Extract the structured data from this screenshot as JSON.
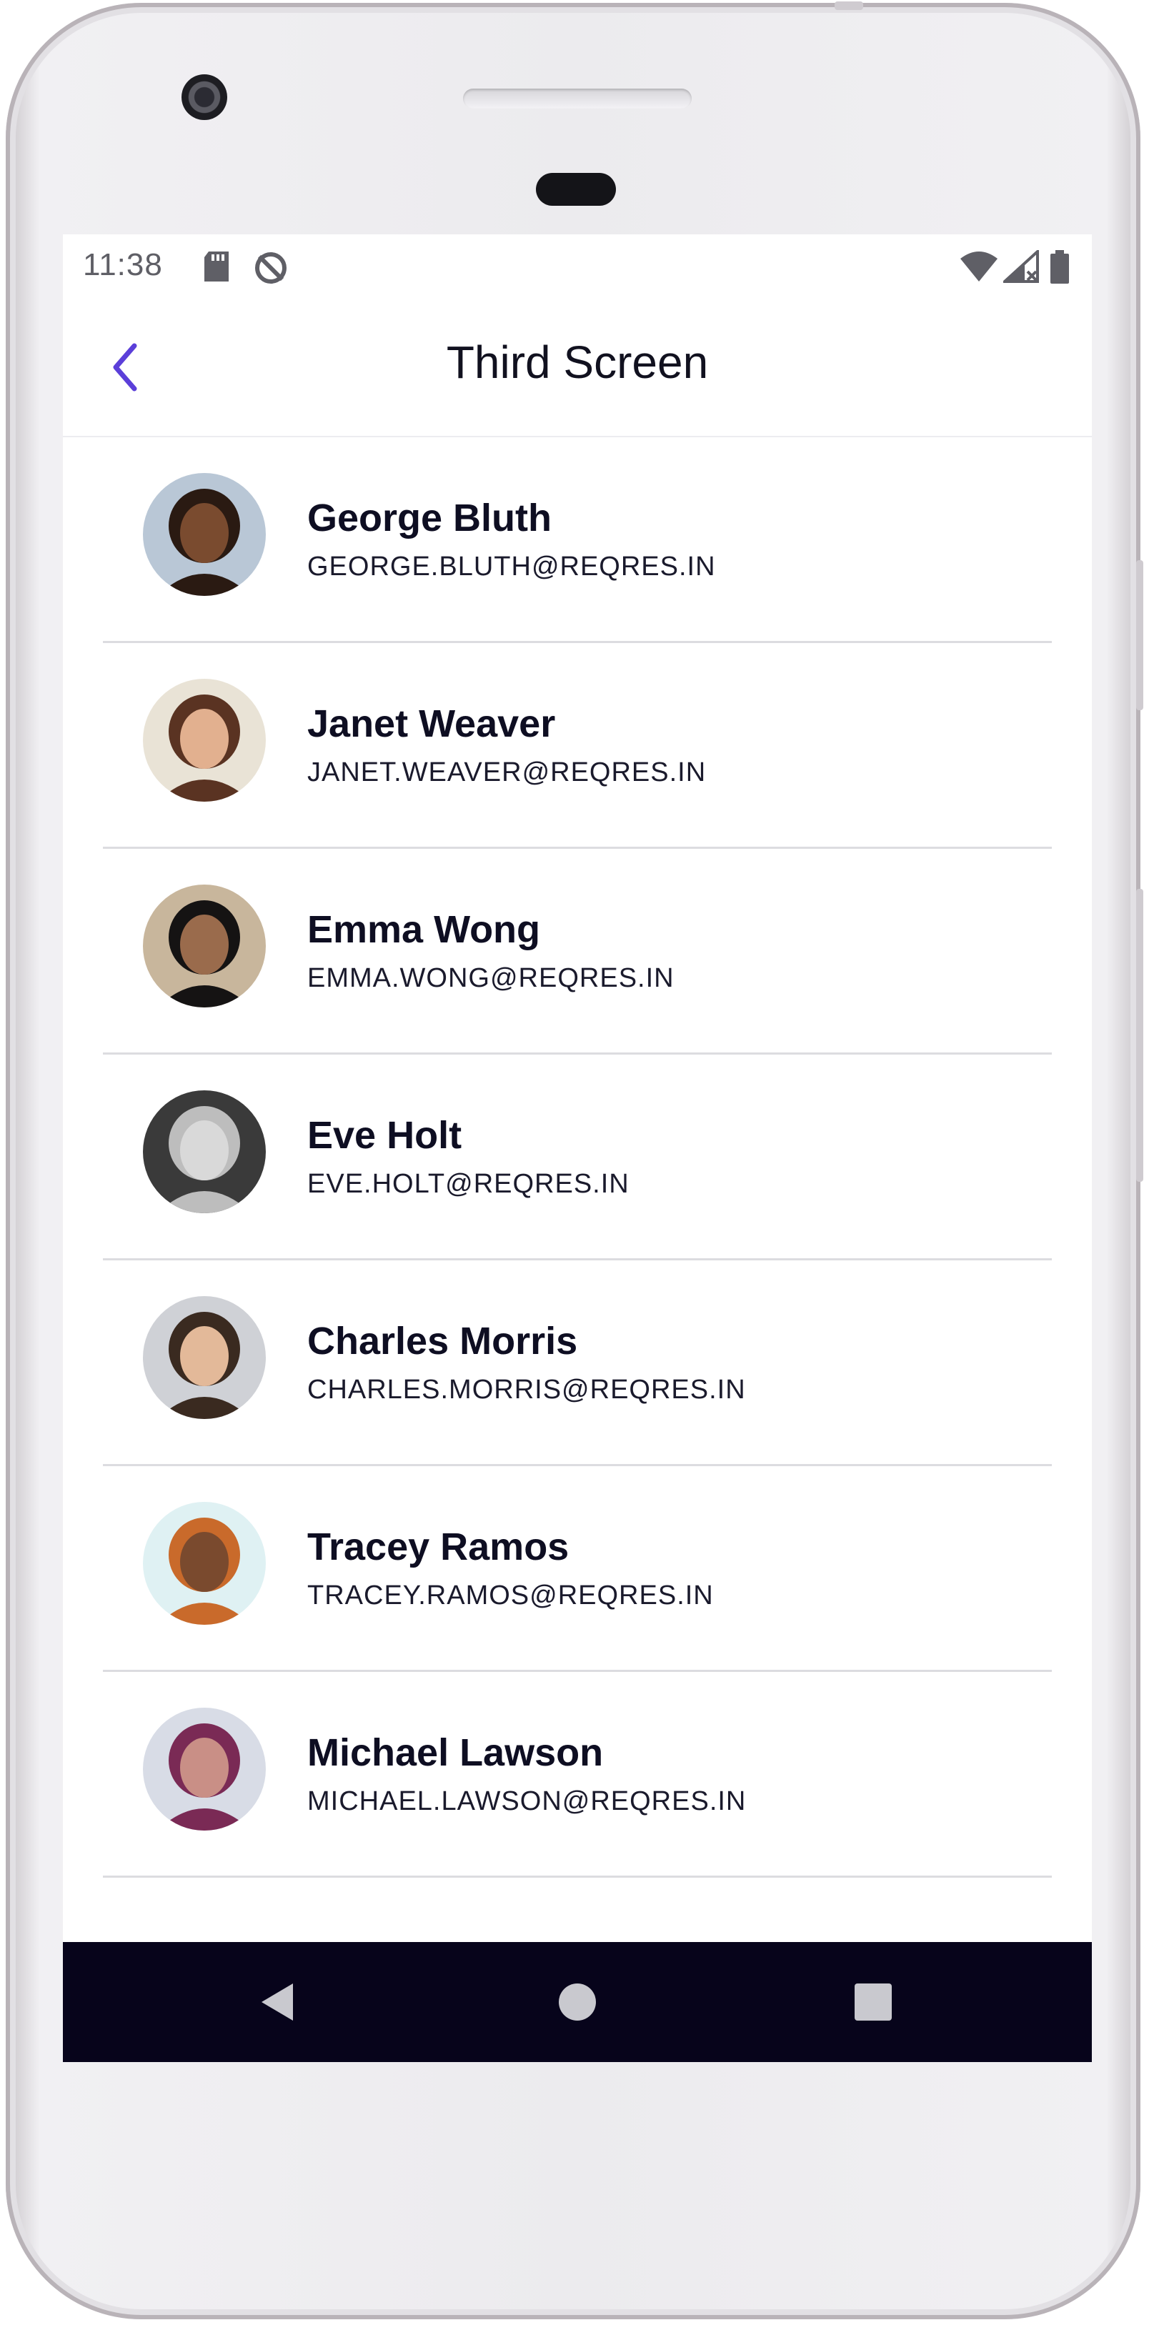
{
  "status_bar": {
    "time": "11:38",
    "icons": [
      "sd-card-icon",
      "sync-disabled-icon",
      "wifi-icon",
      "signal-icon",
      "battery-icon"
    ]
  },
  "app_bar": {
    "title": "Third Screen",
    "back_icon": "chevron-left-icon",
    "accent_color": "#5b3fd9"
  },
  "users": [
    {
      "name": "George Bluth",
      "email": "GEORGE.BLUTH@REQRES.IN",
      "avatar_bg": "#b9c7d6",
      "skin": "#7a4b2f",
      "hair": "#2a1a12"
    },
    {
      "name": "Janet Weaver",
      "email": "JANET.WEAVER@REQRES.IN",
      "avatar_bg": "#e9e3d6",
      "skin": "#e2b08f",
      "hair": "#5a3322"
    },
    {
      "name": "Emma Wong",
      "email": "EMMA.WONG@REQRES.IN",
      "avatar_bg": "#c8b69c",
      "skin": "#9a6b4c",
      "hair": "#151313"
    },
    {
      "name": "Eve Holt",
      "email": "EVE.HOLT@REQRES.IN",
      "avatar_bg": "#3a3a3a",
      "skin": "#d9d9d9",
      "hair": "#bdbdbd"
    },
    {
      "name": "Charles Morris",
      "email": "CHARLES.MORRIS@REQRES.IN",
      "avatar_bg": "#cfd1d6",
      "skin": "#e3b999",
      "hair": "#3a2a20"
    },
    {
      "name": "Tracey Ramos",
      "email": "TRACEY.RAMOS@REQRES.IN",
      "avatar_bg": "#dff1f3",
      "skin": "#7a4a2e",
      "hair": "#c96a2b"
    },
    {
      "name": "Michael Lawson",
      "email": "MICHAEL.LAWSON@REQRES.IN",
      "avatar_bg": "#d8dce6",
      "skin": "#c98f86",
      "hair": "#7a2a55"
    },
    {
      "name": "",
      "email": "",
      "avatar_bg": "#3b3b3b",
      "skin": "#6d4c3d",
      "hair": "#1a1a1a"
    }
  ],
  "nav_bar": {
    "back_icon": "triangle-back-icon",
    "home_icon": "circle-home-icon",
    "recents_icon": "square-recents-icon"
  }
}
